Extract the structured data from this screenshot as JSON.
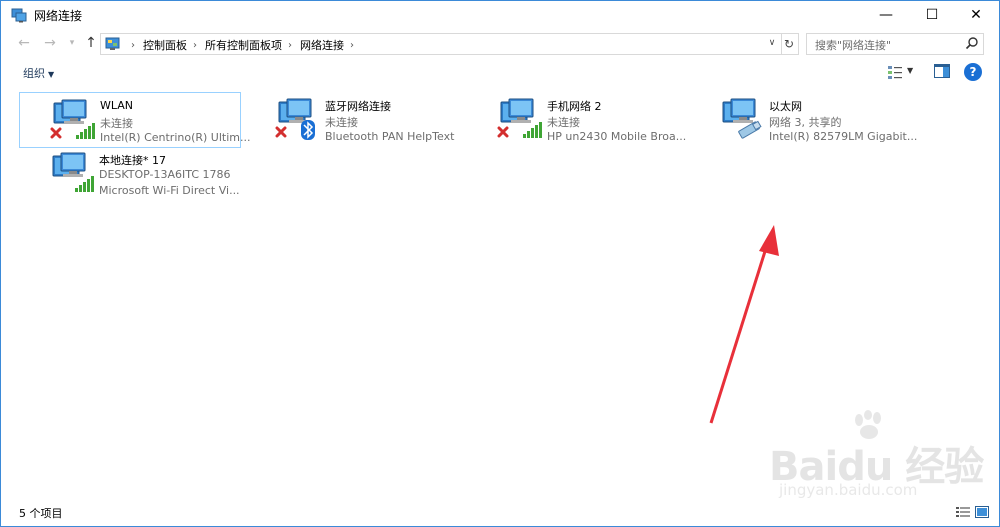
{
  "window": {
    "title": "网络连接"
  },
  "title_buttons": {
    "minimize": "—",
    "maximize": "☐",
    "close": "✕"
  },
  "address_bar": {
    "breadcrumbs": [
      "控制面板",
      "所有控制面板项",
      "网络连接"
    ],
    "separator": "›"
  },
  "search": {
    "placeholder": "搜索\"网络连接\""
  },
  "toolbar": {
    "organize_label": "组织"
  },
  "items": [
    {
      "name": "WLAN",
      "status": "未连接",
      "device": "Intel(R) Centrino(R) Ultim...",
      "type": "wireless",
      "state": "disconnected",
      "selected": true
    },
    {
      "name": "蓝牙网络连接",
      "status": "未连接",
      "device": "Bluetooth PAN HelpText",
      "type": "bluetooth",
      "state": "disconnected",
      "selected": false
    },
    {
      "name": "手机网络 2",
      "status": "未连接",
      "device": "HP un2430 Mobile Broa...",
      "type": "wireless",
      "state": "disconnected",
      "selected": false
    },
    {
      "name": "以太网",
      "status": "网络  3, 共享的",
      "device": "Intel(R) 82579LM Gigabit...",
      "type": "ethernet",
      "state": "connected",
      "selected": false
    },
    {
      "name": "本地连接* 17",
      "status": "DESKTOP-13A6ITC 1786",
      "device": "Microsoft Wi-Fi Direct Vi...",
      "type": "wireless",
      "state": "connected",
      "selected": false
    }
  ],
  "statusbar": {
    "count": "5 个项目"
  },
  "watermark": {
    "brand": "Baidu 经验",
    "url": "jingyan.baidu.com"
  },
  "colors": {
    "accent": "#3b8ad8",
    "arrow": "#e8303a",
    "signal": "#3fa535",
    "error": "#d32f2f"
  }
}
